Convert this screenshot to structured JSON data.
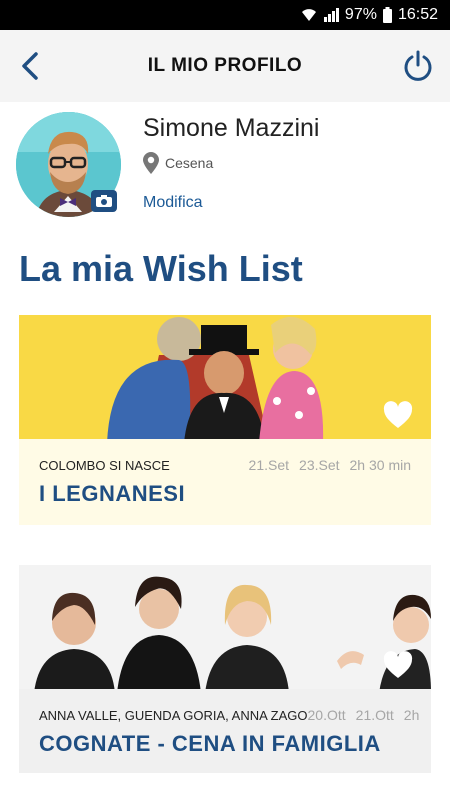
{
  "status_bar": {
    "battery": "97%",
    "time": "16:52"
  },
  "app_bar": {
    "title": "IL MIO PROFILO"
  },
  "profile": {
    "name": "Simone Mazzini",
    "city": "Cesena",
    "edit_label": "Modifica"
  },
  "section_title": "La mia Wish List",
  "wishlist": [
    {
      "subtitle": "COLOMBO SI NASCE",
      "date1": "21.Set",
      "date2": "23.Set",
      "duration": "2h 30 min",
      "title": "I LEGNANESI"
    },
    {
      "subtitle": "ANNA VALLE, GUENDA GORIA, ANNA ZAGO",
      "date1": "20.Ott",
      "date2": "21.Ott",
      "duration": "2h",
      "title": "COGNATE - CENA IN FAMIGLIA"
    }
  ],
  "colors": {
    "accent": "#1f4e82",
    "link": "#1c5a96",
    "card1_bg": "#f7cf1a"
  },
  "icons": [
    "back-icon",
    "power-icon",
    "location-pin-icon",
    "camera-icon",
    "heart-icon",
    "wifi-icon",
    "signal-icon",
    "battery-icon"
  ]
}
